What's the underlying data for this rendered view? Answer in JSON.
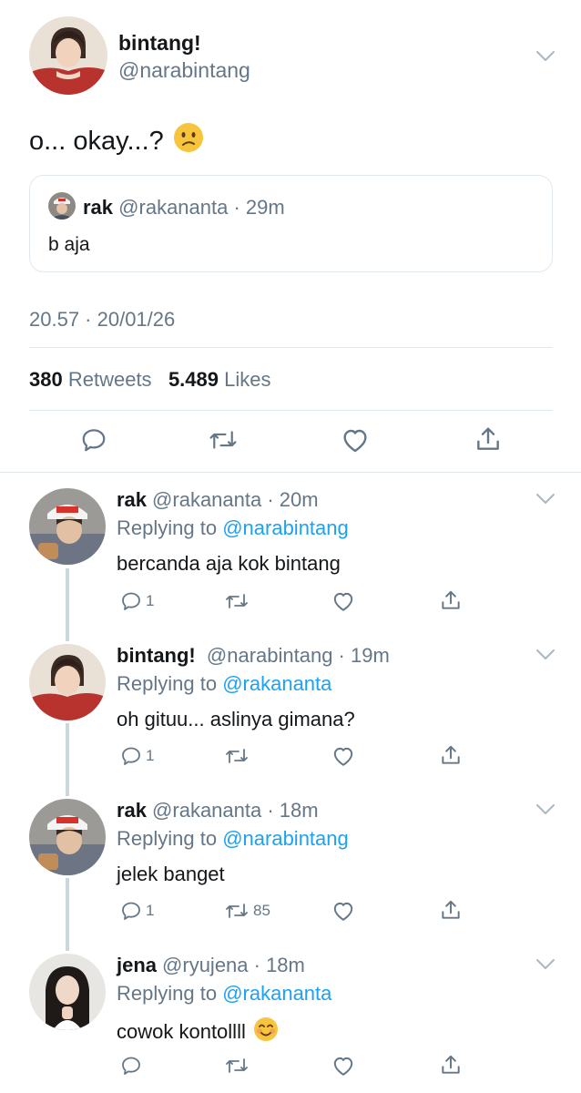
{
  "main": {
    "name": "bintang!",
    "handle": "@narabintang",
    "text": "o... okay...?",
    "emoji_icon": "confused-face-icon",
    "quote": {
      "name": "rak",
      "handle_time": "@rakananta · 29m",
      "text": "b aja"
    },
    "timestamp": "20.57 · 20/01/26",
    "retweets": "380",
    "retweets_label": "Retweets",
    "likes": "5.489",
    "likes_label": "Likes"
  },
  "replies": [
    {
      "name": "rak",
      "handle_time": "@rakananta · 20m",
      "replying_label": "Replying to",
      "replying_to": "@narabintang",
      "text": "bercanda aja kok bintang",
      "reply_count": "1",
      "retweet_count": ""
    },
    {
      "name": "bintang!",
      "handle_time": "@narabintang · 19m",
      "replying_label": "Replying to",
      "replying_to": "@rakananta",
      "text": "oh gituu... aslinya gimana?",
      "reply_count": "1",
      "retweet_count": ""
    },
    {
      "name": "rak",
      "handle_time": "@rakananta · 18m",
      "replying_label": "Replying to",
      "replying_to": "@narabintang",
      "text": "jelek banget",
      "reply_count": "1",
      "retweet_count": "85"
    },
    {
      "name": "jena",
      "handle_time": "@ryujena · 18m",
      "replying_label": "Replying to",
      "replying_to": "@rakananta",
      "text": "cowok kontollll",
      "emoji_icon": "smiling-face-icon",
      "reply_count": "",
      "retweet_count": ""
    }
  ],
  "colors": {
    "text": "#14171a",
    "secondary": "#657786",
    "link": "#1da1f2",
    "border": "#e1e8ed",
    "thread_line": "#ccd6dd"
  }
}
